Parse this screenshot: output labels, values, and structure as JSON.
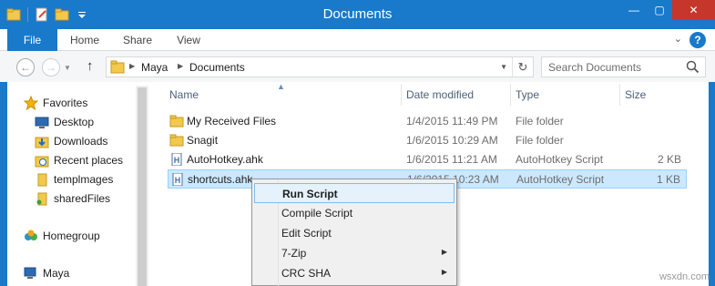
{
  "window": {
    "title": "Documents"
  },
  "ribbon": {
    "tabs": [
      "File",
      "Home",
      "Share",
      "View"
    ],
    "help": "?"
  },
  "address": {
    "crumbs": [
      "Maya",
      "Documents"
    ]
  },
  "search": {
    "placeholder": "Search Documents"
  },
  "nav_pane": {
    "items": [
      {
        "label": "Favorites",
        "icon": "star-icon"
      },
      {
        "label": "Desktop",
        "icon": "desktop-icon"
      },
      {
        "label": "Downloads",
        "icon": "downloads-icon"
      },
      {
        "label": "Recent places",
        "icon": "recent-places-icon"
      },
      {
        "label": "templmages",
        "icon": "folder-icon"
      },
      {
        "label": "sharedFiles",
        "icon": "shared-folder-icon"
      },
      {
        "label": "Homegroup",
        "icon": "homegroup-icon"
      },
      {
        "label": "Maya",
        "icon": "computer-icon"
      }
    ]
  },
  "file_list": {
    "columns": [
      "Name",
      "Date modified",
      "Type",
      "Size"
    ],
    "rows": [
      {
        "name": "My Received Files",
        "date": "1/4/2015 11:49 PM",
        "type": "File folder",
        "size": "",
        "icon": "folder-icon"
      },
      {
        "name": "Snagit",
        "date": "1/6/2015 10:29 AM",
        "type": "File folder",
        "size": "",
        "icon": "folder-icon"
      },
      {
        "name": "AutoHotkey.ahk",
        "date": "1/6/2015 11:21 AM",
        "type": "AutoHotkey Script",
        "size": "2 KB",
        "icon": "ahk-file-icon"
      },
      {
        "name": "shortcuts.ahk",
        "date": "1/6/2015 10:23 AM",
        "type": "AutoHotkey Script",
        "size": "1 KB",
        "icon": "ahk-file-icon"
      }
    ]
  },
  "context_menu": {
    "items": [
      {
        "label": "Run Script",
        "submenu": false
      },
      {
        "label": "Compile Script",
        "submenu": false
      },
      {
        "label": "Edit Script",
        "submenu": false
      },
      {
        "label": "7-Zip",
        "submenu": true
      },
      {
        "label": "CRC SHA",
        "submenu": true
      }
    ]
  },
  "watermark": "wsxdn.com",
  "colors": {
    "accent": "#1979ca",
    "selection": "#cce8ff",
    "close": "#c7362b"
  }
}
